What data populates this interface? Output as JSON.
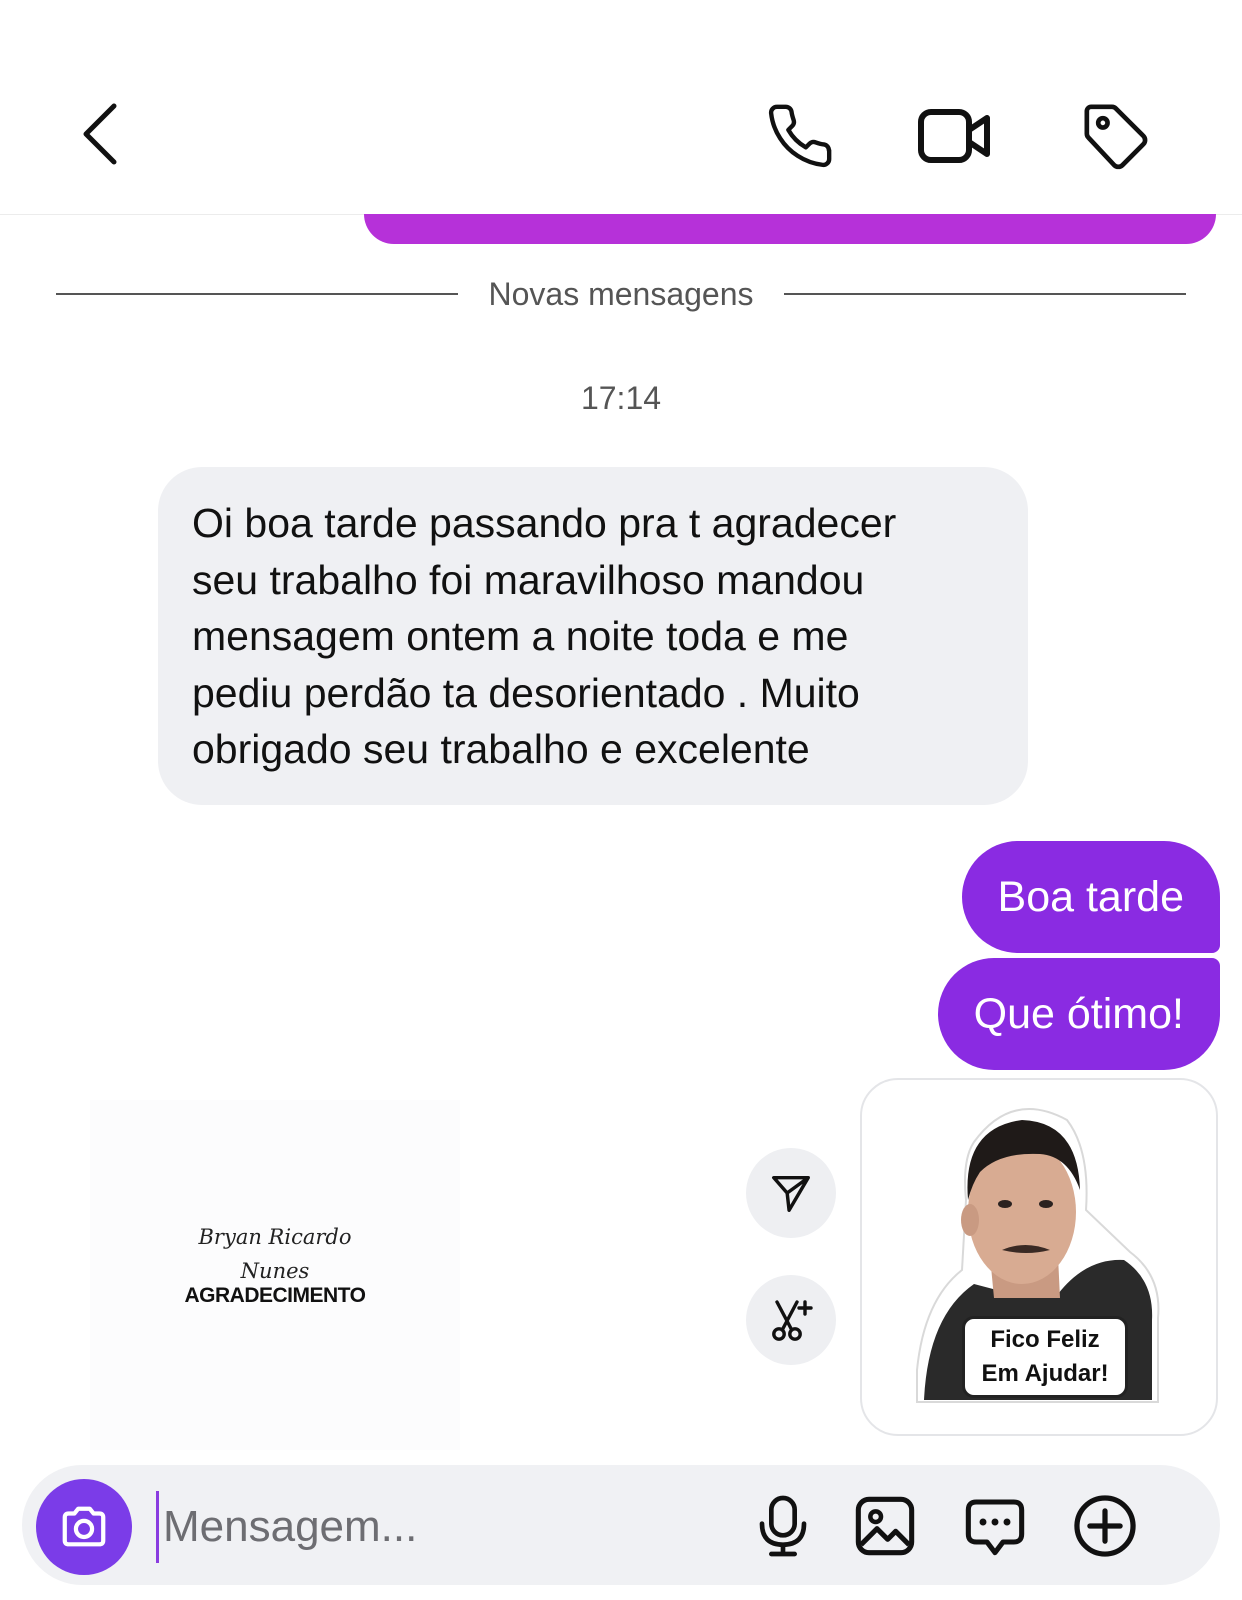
{
  "header": {
    "back_icon": "chevron-left-icon",
    "actions": [
      "phone-icon",
      "video-icon",
      "tag-icon"
    ]
  },
  "divider": {
    "label": "Novas mensagens"
  },
  "thread": {
    "timestamp": "17:14",
    "incoming": {
      "lines": [
        "Oi boa tarde passando pra t agradecer",
        "seu trabalho foi maravilhoso mandou",
        "mensagem ontem a noite toda e me",
        "pediu perdão ta desorientado . Muito",
        "obrigado seu trabalho e excelente"
      ]
    },
    "outgoing": [
      {
        "text": "Boa tarde"
      },
      {
        "text": "Que ótimo!"
      }
    ],
    "shared_card": {
      "signature_line1": "Bryan Ricardo",
      "signature_line2": "Nunes",
      "title": "AGRADECIMENTO"
    },
    "sticker": {
      "caption_line1": "Fico Feliz",
      "caption_line2": "Em Ajudar!"
    },
    "action_buttons": [
      "send-icon",
      "scissors-sparkle-icon"
    ]
  },
  "composer": {
    "placeholder": "Mensagem...",
    "icons": [
      "camera-icon",
      "microphone-icon",
      "gallery-icon",
      "chat-bubble-icon",
      "plus-circle-icon"
    ]
  },
  "colors": {
    "outgoing_bubble": "#8a2be2",
    "incoming_bubble": "#eff0f3",
    "camera_button": "#7b3ce8",
    "top_partial_bubble": "#b631d9"
  }
}
